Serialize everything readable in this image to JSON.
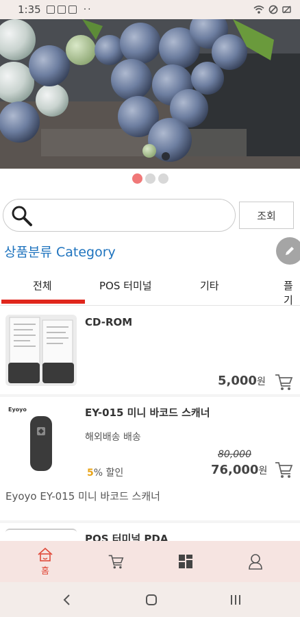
{
  "status_bar": {
    "time": "1:35"
  },
  "banner": {
    "slides": 3,
    "active_index": 0
  },
  "search": {
    "value": "",
    "placeholder": "",
    "button_label": "조회"
  },
  "category": {
    "title": "상품분류 Category"
  },
  "tabs": [
    {
      "label": "전체",
      "active": true
    },
    {
      "label": "POS 터미널",
      "active": false
    },
    {
      "label": "기타",
      "active": false
    },
    {
      "label": "플기",
      "active": false
    }
  ],
  "products": [
    {
      "name": "CD-ROM",
      "price": "5,000",
      "currency": "원"
    },
    {
      "name": "EY-015 미니 바코드 스캐너",
      "shipping": "해외배송 배송",
      "original_price": "80,000",
      "price": "76,000",
      "currency": "원",
      "discount_pct": "5",
      "discount_unit": "% 할인",
      "description": "Eyoyo EY-015 미니 바코드 스캐너",
      "thumb_brand": "Eyoyo"
    },
    {
      "name": "POS 터미널 PDA"
    }
  ],
  "bottom_nav": [
    {
      "label": "홈",
      "icon": "home-icon",
      "active": true
    },
    {
      "label": "",
      "icon": "cart-icon",
      "active": false
    },
    {
      "label": "",
      "icon": "grid-icon",
      "active": false
    },
    {
      "label": "",
      "icon": "user-icon",
      "active": false
    }
  ],
  "colors": {
    "accent_red": "#e0261c",
    "category_blue": "#1e73be",
    "discount_orange": "#e8a317",
    "nav_bg": "#f6e4e1"
  }
}
